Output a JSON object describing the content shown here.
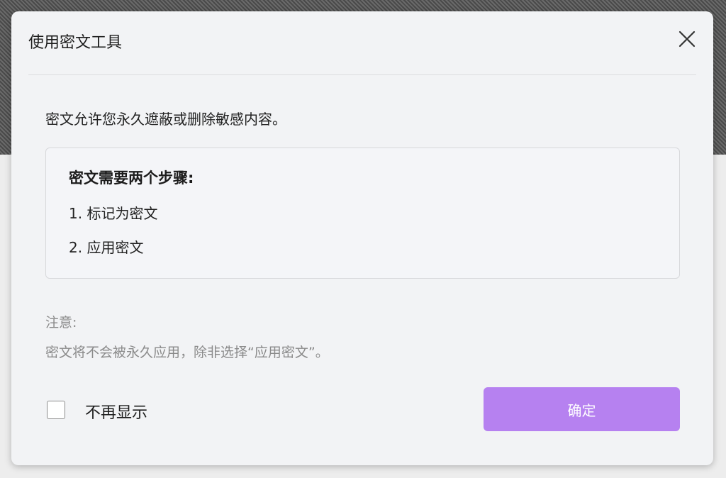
{
  "dialog": {
    "title": "使用密文工具",
    "close_icon": "close-icon",
    "description": "密文允许您永久遮蔽或删除敏感内容。",
    "steps": {
      "heading": "密文需要两个步骤:",
      "items": [
        "1. 标记为密文",
        "2. 应用密文"
      ]
    },
    "note": {
      "label": "注意:",
      "text": "密文将不会被永久应用，除非选择“应用密文”。"
    },
    "dont_show_again": {
      "label": "不再显示",
      "checked": false
    },
    "confirm_label": "确定"
  },
  "colors": {
    "accent": "#b681f0",
    "dialog_bg": "#f2f3f5",
    "muted_text": "#8a8a8a"
  }
}
